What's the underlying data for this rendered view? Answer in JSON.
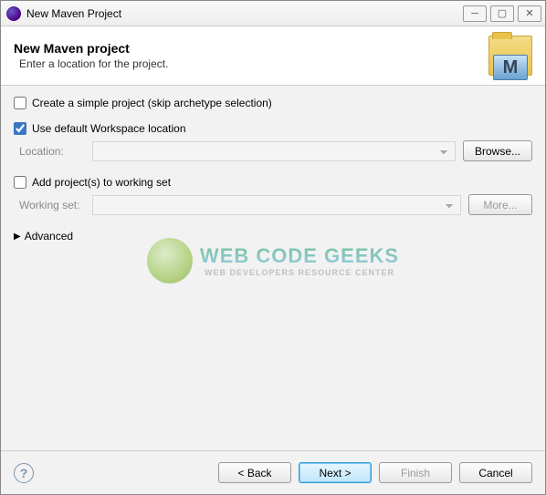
{
  "window": {
    "title": "New Maven Project"
  },
  "header": {
    "title": "New Maven project",
    "subtitle": "Enter a location for the project.",
    "icon_letter": "M"
  },
  "form": {
    "simple_project_label": "Create a simple project (skip archetype selection)",
    "simple_project_checked": false,
    "use_default_label": "Use default Workspace location",
    "use_default_checked": true,
    "location_label": "Location:",
    "location_value": "",
    "browse_label": "Browse...",
    "working_set_checkbox_label": "Add project(s) to working set",
    "working_set_checked": false,
    "working_set_label": "Working set:",
    "working_set_value": "",
    "more_label": "More...",
    "advanced_label": "Advanced"
  },
  "watermark": {
    "line1": "WEB CODE GEEKS",
    "line2": "WEB DEVELOPERS RESOURCE CENTER"
  },
  "footer": {
    "back": "< Back",
    "next": "Next >",
    "finish": "Finish",
    "cancel": "Cancel"
  }
}
